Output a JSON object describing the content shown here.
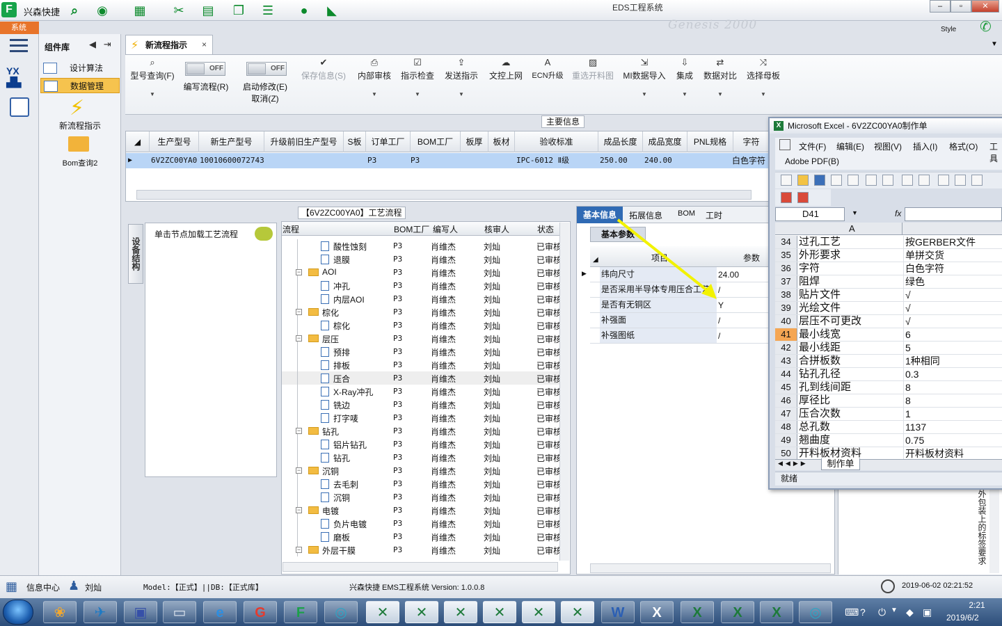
{
  "app": {
    "name": "兴森快捷",
    "window_title": "EDS工程系统",
    "style_label": "Style",
    "system_tab": "系统",
    "banner_text": "Genesis 2000"
  },
  "window_controls": {
    "minimize": "–",
    "restore": "▫",
    "close": "✕"
  },
  "component_panel": {
    "title": "组件库",
    "items": [
      {
        "label": "设计算法"
      },
      {
        "label": "数据管理"
      }
    ],
    "tools": [
      {
        "label": "新流程指示"
      },
      {
        "label": "Bom查询2"
      }
    ]
  },
  "doc_tab": {
    "label": "新流程指示",
    "close": "×"
  },
  "ribbon": {
    "buttons": [
      {
        "label": "型号查询(F)",
        "icon": "search-icon"
      },
      {
        "label": "保存信息(S)",
        "icon": "check-icon",
        "disabled": true
      },
      {
        "label": "内部审核",
        "icon": "printer-icon"
      },
      {
        "label": "指示检查",
        "icon": "checkbox-icon"
      },
      {
        "label": "发送指示",
        "icon": "upload-icon"
      },
      {
        "label": "文控上网",
        "icon": "cloud-icon"
      },
      {
        "label": "ECN升级",
        "icon": "letter-a-icon"
      },
      {
        "label": "重选开料图",
        "icon": "image-icon",
        "disabled": true
      },
      {
        "label": "MI数据导入",
        "icon": "import-icon"
      },
      {
        "label": "集成",
        "icon": "download-icon"
      },
      {
        "label": "数据对比",
        "icon": "compare-icon"
      },
      {
        "label": "选择母板",
        "icon": "shuffle-icon"
      }
    ],
    "toggles": [
      {
        "state": "OFF",
        "label": "编写流程(R)"
      },
      {
        "state": "OFF",
        "label": "启动修改(E)",
        "label2": "取消(Z)"
      }
    ]
  },
  "main_info": {
    "title": "主要信息",
    "columns": [
      "生产型号",
      "新生产型号",
      "升级前旧生产型号",
      "S板",
      "订单工厂",
      "BOM工厂",
      "板厚",
      "板材",
      "验收标准",
      "成品长度",
      "成品宽度",
      "PNL规格",
      "字符"
    ],
    "row": {
      "model": "6V2ZC00YA0",
      "new_model": "10010600072743",
      "order_factory": "P3",
      "bom_factory": "P3",
      "standard": "IPC-6012 Ⅱ级",
      "length": "250.00",
      "width": "240.00",
      "char": "白色字符"
    }
  },
  "process": {
    "title": "【6V2ZC00YA0】工艺流程",
    "side_tab": "设备结构",
    "hint": "单击节点加载工艺流程",
    "columns": [
      "流程",
      "BOM工厂",
      "编写人",
      "核审人",
      "状态"
    ],
    "rows": [
      {
        "type": "leaf",
        "name": "酸性蚀刻",
        "factory": "P3",
        "writer": "肖维杰",
        "reviewer": "刘灿",
        "status": "已审核"
      },
      {
        "type": "leaf",
        "name": "退膜",
        "factory": "P3",
        "writer": "肖维杰",
        "reviewer": "刘灿",
        "status": "已审核"
      },
      {
        "type": "folder",
        "name": "AOI",
        "factory": "P3",
        "writer": "肖维杰",
        "reviewer": "刘灿",
        "status": "已审核"
      },
      {
        "type": "leaf",
        "name": "冲孔",
        "factory": "P3",
        "writer": "肖维杰",
        "reviewer": "刘灿",
        "status": "已审核"
      },
      {
        "type": "leaf",
        "name": "内层AOI",
        "factory": "P3",
        "writer": "肖维杰",
        "reviewer": "刘灿",
        "status": "已审核"
      },
      {
        "type": "folder",
        "name": "棕化",
        "factory": "P3",
        "writer": "肖维杰",
        "reviewer": "刘灿",
        "status": "已审核"
      },
      {
        "type": "leaf",
        "name": "棕化",
        "factory": "P3",
        "writer": "肖维杰",
        "reviewer": "刘灿",
        "status": "已审核"
      },
      {
        "type": "folder",
        "name": "层压",
        "factory": "P3",
        "writer": "肖维杰",
        "reviewer": "刘灿",
        "status": "已审核"
      },
      {
        "type": "leaf",
        "name": "预排",
        "factory": "P3",
        "writer": "肖维杰",
        "reviewer": "刘灿",
        "status": "已审核"
      },
      {
        "type": "leaf",
        "name": "排板",
        "factory": "P3",
        "writer": "肖维杰",
        "reviewer": "刘灿",
        "status": "已审核"
      },
      {
        "type": "leaf",
        "name": "压合",
        "factory": "P3",
        "writer": "肖维杰",
        "reviewer": "刘灿",
        "status": "已审核"
      },
      {
        "type": "leaf",
        "name": "X-Ray冲孔",
        "factory": "P3",
        "writer": "肖维杰",
        "reviewer": "刘灿",
        "status": "已审核"
      },
      {
        "type": "leaf",
        "name": "铣边",
        "factory": "P3",
        "writer": "肖维杰",
        "reviewer": "刘灿",
        "status": "已审核"
      },
      {
        "type": "leaf",
        "name": "打字唛",
        "factory": "P3",
        "writer": "肖维杰",
        "reviewer": "刘灿",
        "status": "已审核"
      },
      {
        "type": "folder",
        "name": "钻孔",
        "factory": "P3",
        "writer": "肖维杰",
        "reviewer": "刘灿",
        "status": "已审核"
      },
      {
        "type": "leaf",
        "name": "铝片钻孔",
        "factory": "P3",
        "writer": "肖维杰",
        "reviewer": "刘灿",
        "status": "已审核"
      },
      {
        "type": "leaf",
        "name": "钻孔",
        "factory": "P3",
        "writer": "肖维杰",
        "reviewer": "刘灿",
        "status": "已审核"
      },
      {
        "type": "folder",
        "name": "沉铜",
        "factory": "P3",
        "writer": "肖维杰",
        "reviewer": "刘灿",
        "status": "已审核"
      },
      {
        "type": "leaf",
        "name": "去毛刺",
        "factory": "P3",
        "writer": "肖维杰",
        "reviewer": "刘灿",
        "status": "已审核"
      },
      {
        "type": "leaf",
        "name": "沉铜",
        "factory": "P3",
        "writer": "肖维杰",
        "reviewer": "刘灿",
        "status": "已审核"
      },
      {
        "type": "folder",
        "name": "电镀",
        "factory": "P3",
        "writer": "肖维杰",
        "reviewer": "刘灿",
        "status": "已审核"
      },
      {
        "type": "leaf",
        "name": "负片电镀",
        "factory": "P3",
        "writer": "肖维杰",
        "reviewer": "刘灿",
        "status": "已审核"
      },
      {
        "type": "leaf",
        "name": "磨板",
        "factory": "P3",
        "writer": "肖维杰",
        "reviewer": "刘灿",
        "status": "已审核"
      },
      {
        "type": "folder",
        "name": "外层干膜",
        "factory": "P3",
        "writer": "肖维杰",
        "reviewer": "刘灿",
        "status": "已审核"
      }
    ]
  },
  "info_panel": {
    "tabs": [
      "基本信息",
      "拓展信息",
      "BOM",
      "工时"
    ],
    "sub_tab": "基本参数",
    "columns": [
      "项目",
      "参数"
    ],
    "rows": [
      {
        "item": "纬向尺寸",
        "value": "24.00"
      },
      {
        "item": "是否采用半导体专用压合工艺",
        "value": "/"
      },
      {
        "item": "是否有无铜区",
        "value": "Y"
      },
      {
        "item": "补强面",
        "value": "/"
      },
      {
        "item": "补强图纸",
        "value": "/"
      }
    ]
  },
  "excel": {
    "title": "Microsoft Excel - 6V2ZC00YA0制作单",
    "menu": [
      "文件(F)",
      "编辑(E)",
      "视图(V)",
      "插入(I)",
      "格式(O)",
      "工具"
    ],
    "pdf_menu": "Adobe PDF(B)",
    "name_box": "D41",
    "fx": "fx",
    "col_a": "A",
    "rows": [
      {
        "n": "34",
        "a": "过孔工艺",
        "b": "按GERBER文件"
      },
      {
        "n": "35",
        "a": "外形要求",
        "b": "单拼交货"
      },
      {
        "n": "36",
        "a": "字符",
        "b": "白色字符"
      },
      {
        "n": "37",
        "a": "阻焊",
        "b": "绿色"
      },
      {
        "n": "38",
        "a": "贴片文件",
        "b": "√"
      },
      {
        "n": "39",
        "a": "光绘文件",
        "b": "√"
      },
      {
        "n": "40",
        "a": "层压不可更改",
        "b": "√"
      },
      {
        "n": "41",
        "a": "最小线宽",
        "b": "6",
        "active": true
      },
      {
        "n": "42",
        "a": "最小线距",
        "b": "5"
      },
      {
        "n": "43",
        "a": "合拼板数",
        "b": "1种相同"
      },
      {
        "n": "44",
        "a": "钻孔孔径",
        "b": "0.3"
      },
      {
        "n": "45",
        "a": "孔到线间距",
        "b": "8"
      },
      {
        "n": "46",
        "a": "厚径比",
        "b": "8"
      },
      {
        "n": "47",
        "a": "压合次数",
        "b": "1"
      },
      {
        "n": "48",
        "a": "总孔数",
        "b": "1137"
      },
      {
        "n": "49",
        "a": "翘曲度",
        "b": "0.75"
      },
      {
        "n": "50",
        "a": "开料板材资料",
        "b": "开料板材资料"
      }
    ],
    "sheet_tab": "制作单",
    "status": "就绪"
  },
  "side_note": "外包装上的标签要求",
  "statusbar": {
    "info_center": "信息中心",
    "user": "刘灿",
    "model": "Model:【正式】||DB:【正式库】",
    "version": "兴森快捷 EMS工程系统 Version: 1.0.0.8",
    "datetime": "2019-06-02 02:21:52"
  },
  "taskbar": {
    "time": "2:21",
    "date": "2019/6/2"
  },
  "colors": {
    "accent": "#2f6ab4",
    "selection": "#b9d5f6",
    "excel_active_row": "#f5a653",
    "arrow": "#f2f200"
  }
}
